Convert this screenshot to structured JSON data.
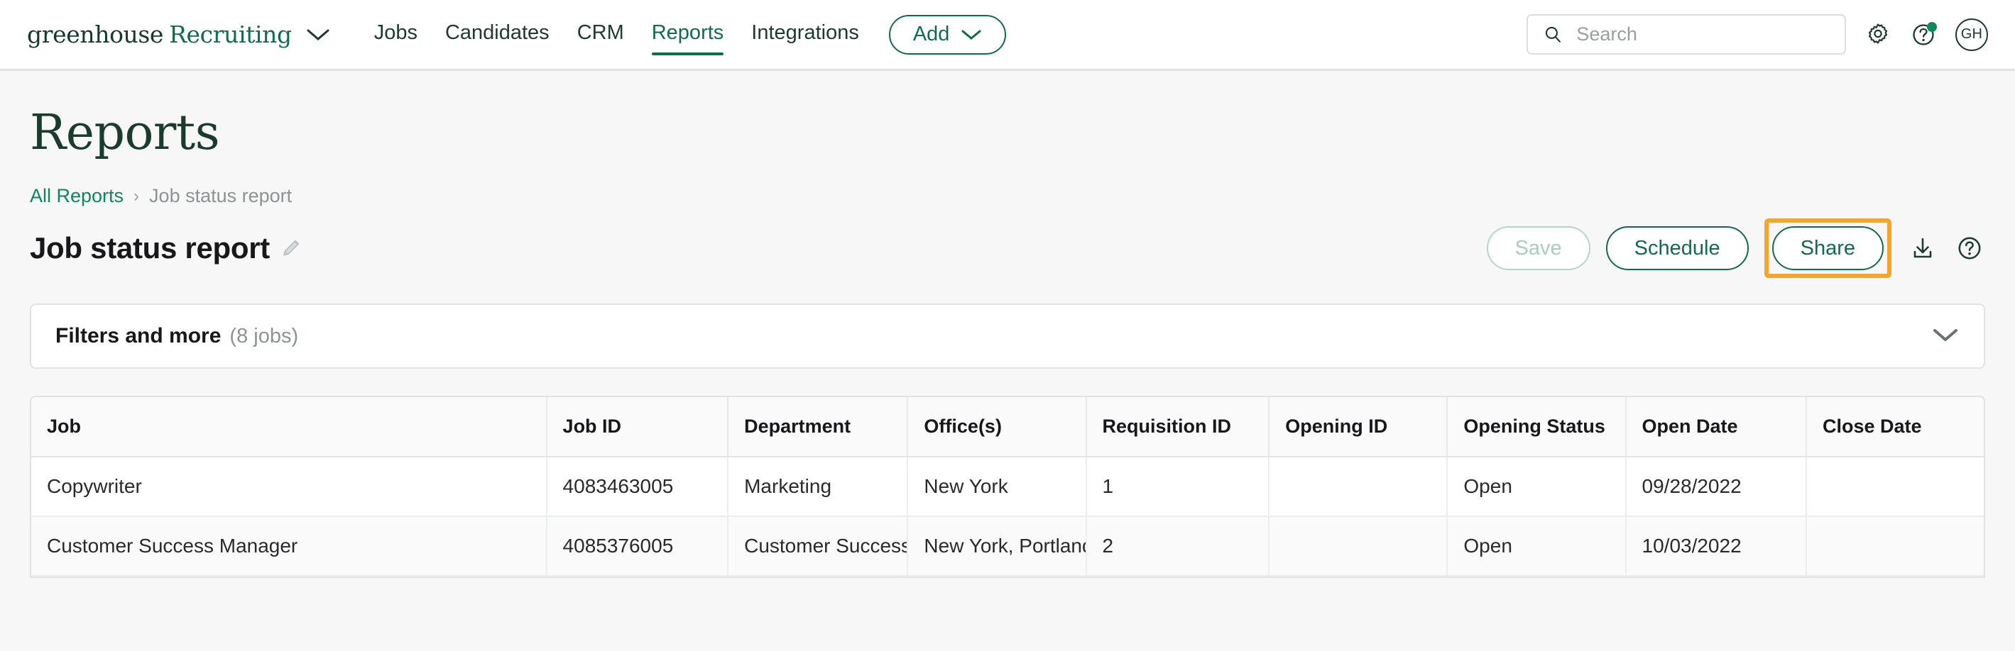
{
  "nav": {
    "brand_primary": "greenhouse",
    "brand_secondary": "Recruiting",
    "links": [
      {
        "label": "Jobs",
        "active": false
      },
      {
        "label": "Candidates",
        "active": false
      },
      {
        "label": "CRM",
        "active": false
      },
      {
        "label": "Reports",
        "active": true
      },
      {
        "label": "Integrations",
        "active": false
      }
    ],
    "add_button": "Add",
    "search_placeholder": "Search",
    "search_value": "",
    "avatar_initials": "GH"
  },
  "page": {
    "title": "Reports"
  },
  "breadcrumb": {
    "root": "All Reports",
    "separator": "›",
    "current": "Job status report"
  },
  "report": {
    "name": "Job status report",
    "actions": {
      "save": "Save",
      "schedule": "Schedule",
      "share": "Share"
    }
  },
  "filters": {
    "title": "Filters and more",
    "count": "(8 jobs)"
  },
  "table": {
    "columns": [
      "Job",
      "Job ID",
      "Department",
      "Office(s)",
      "Requisition ID",
      "Opening ID",
      "Opening Status",
      "Open Date",
      "Close Date"
    ],
    "rows": [
      {
        "job": "Copywriter",
        "job_id": "4083463005",
        "department": "Marketing",
        "offices": "New York",
        "requisition_id": "1",
        "opening_id": "",
        "opening_status": "Open",
        "open_date": "09/28/2022",
        "close_date": ""
      },
      {
        "job": "Customer Success Manager",
        "job_id": "4085376005",
        "department": "Customer Success",
        "offices": "New York, Portland",
        "requisition_id": "2",
        "opening_id": "",
        "opening_status": "Open",
        "open_date": "10/03/2022",
        "close_date": ""
      }
    ]
  },
  "colors": {
    "brand_green": "#0f6e47",
    "dark_green": "#1a3b2e",
    "highlight_orange": "#f6a528",
    "link_green": "#10875a",
    "page_bg": "#f7f7f7"
  }
}
